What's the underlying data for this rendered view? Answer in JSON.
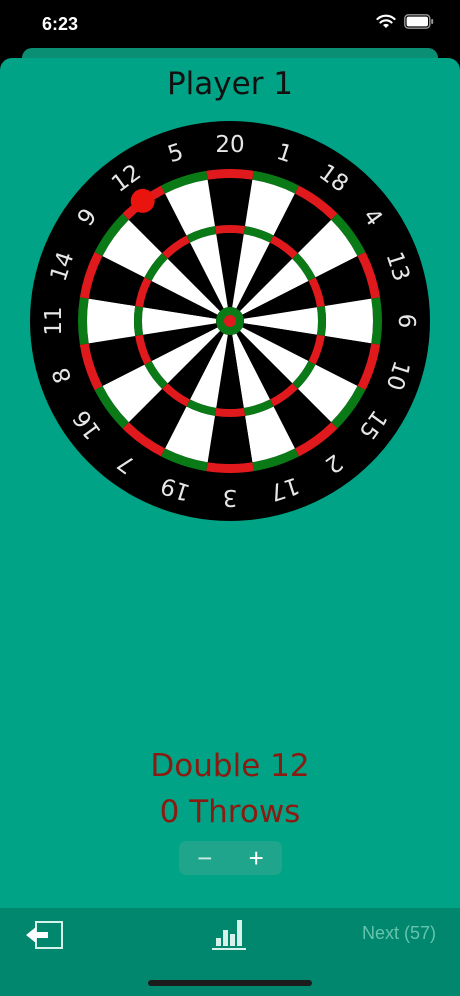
{
  "status_bar": {
    "time": "6:23"
  },
  "header": {
    "player_name": "Player 1"
  },
  "dartboard": {
    "numbers": [
      "20",
      "1",
      "18",
      "4",
      "13",
      "6",
      "10",
      "15",
      "2",
      "17",
      "3",
      "19",
      "7",
      "16",
      "8",
      "11",
      "14",
      "9",
      "12",
      "5"
    ],
    "highlighted_segment": "12",
    "colors": {
      "black": "#000000",
      "white": "#ffffff",
      "red": "#e0191d",
      "green": "#0a7a16"
    }
  },
  "target": {
    "label": "Double 12",
    "throws": "0 Throws"
  },
  "stepper": {
    "minus": "−",
    "plus": "+"
  },
  "bottom_bar": {
    "next_label": "Next (57)",
    "back_icon": "exit-icon",
    "stats_icon": "bar-chart-icon"
  },
  "colors": {
    "background": "#00a385",
    "bottom_bar": "#00876e",
    "target_text": "#8b1a10"
  }
}
